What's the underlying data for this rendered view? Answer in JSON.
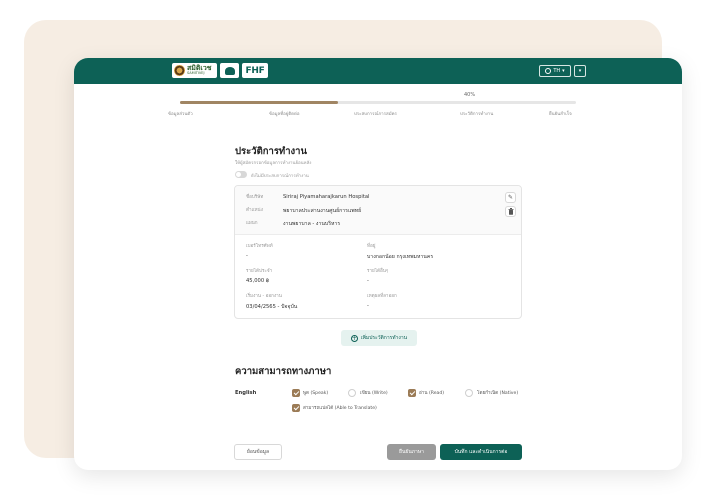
{
  "header": {
    "logo_samitivej_main": "สมิติเวช",
    "logo_samitivej_sub": "SAMITIVEJ",
    "logo_fhf": "FHF",
    "language": "TH",
    "language_caret": "▾",
    "menu_caret": "▾",
    "brand_color": "#0d6156"
  },
  "progress": {
    "percent_label": "40%",
    "value": 0.4,
    "steps": [
      {
        "label": "ข้อมูลส่วนตัว"
      },
      {
        "label": "ข้อมูลที่อยู่ติดต่อ"
      },
      {
        "label": "ประสบการณ์การสมัคร"
      },
      {
        "label": "ประวัติการทำงาน"
      },
      {
        "label": "ยืนยันสำเร็จ"
      }
    ]
  },
  "work_history": {
    "title": "ประวัติการทำงาน",
    "subtitle": "ให้ผู้สมัครกรอกข้อมูลการทำงานย้อนหลัง",
    "toggle_label": "ยังไม่มีประสบการณ์การทำงาน",
    "entry": {
      "company_label": "ชื่อบริษัท",
      "company_value": "Siriraj Piyamaharajkarun Hospital",
      "position_label": "ตำแหน่ง",
      "position_value": "พยาบาลประสานงานศูนย์การแพทย์",
      "department_label": "แผนก",
      "department_value": "งานพยาบาล - งานบริหาร",
      "phone_label": "เบอร์โทรศัพท์",
      "phone_value": "-",
      "address_label": "ที่อยู่",
      "address_value": "บางกอกน้อย กรุงเทพมหานคร",
      "salary_label": "รายได้ประจำ",
      "salary_value": "45,000 ฿",
      "other_income_label": "รายได้อื่นๆ",
      "other_income_value": "-",
      "period_label": "เริ่มงาน - ออกงาน",
      "period_value": "03/04/2565 - ปัจจุบัน",
      "reason_label": "เหตุผลที่ลาออก",
      "reason_value": "-"
    },
    "edit_icon": "pencil-icon",
    "delete_icon": "trash-icon",
    "add_button": "เพิ่มประวัติการทำงาน",
    "add_symbol": "+"
  },
  "language_skills": {
    "title": "ความสามารถทางภาษา",
    "language": "English",
    "options": [
      {
        "label": "พูด (Speak)",
        "checked": true
      },
      {
        "label": "เขียน (Write)",
        "checked": false
      },
      {
        "label": "อ่าน (Read)",
        "checked": true
      },
      {
        "label": "โดยกำเนิด (Native)",
        "checked": false
      },
      {
        "label": "สามารถแปลได้ (Able to Translate)",
        "checked": true
      }
    ],
    "checked_color": "#9b7b56"
  },
  "footer": {
    "back_label": "ย้อนข้อมูล",
    "reject_label": "ยืนยันภาษา",
    "save_label": "บันทึก และดำเนินการต่อ"
  }
}
